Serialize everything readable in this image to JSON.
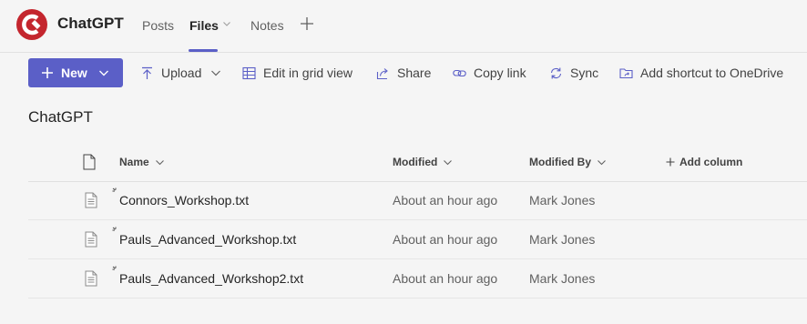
{
  "header": {
    "app_title": "ChatGPT",
    "tabs": [
      {
        "label": "Posts"
      },
      {
        "label": "Files"
      },
      {
        "label": "Notes"
      }
    ],
    "active_tab": "Files",
    "accent": "#5b5fc7",
    "logo_color": "#c4262e"
  },
  "commands": {
    "new_label": "New",
    "upload_label": "Upload",
    "grid_label": "Edit in grid view",
    "share_label": "Share",
    "copy_label": "Copy link",
    "sync_label": "Sync",
    "shortcut_label": "Add shortcut to OneDrive"
  },
  "folder": {
    "title": "ChatGPT"
  },
  "table": {
    "columns": {
      "name": "Name",
      "modified": "Modified",
      "modified_by": "Modified By",
      "add_column": "Add column"
    },
    "rows": [
      {
        "name": "Connors_Workshop.txt",
        "modified": "About an hour ago",
        "modified_by": "Mark Jones"
      },
      {
        "name": "Pauls_Advanced_Workshop.txt",
        "modified": "About an hour ago",
        "modified_by": "Mark Jones"
      },
      {
        "name": "Pauls_Advanced_Workshop2.txt",
        "modified": "About an hour ago",
        "modified_by": "Mark Jones"
      }
    ]
  }
}
